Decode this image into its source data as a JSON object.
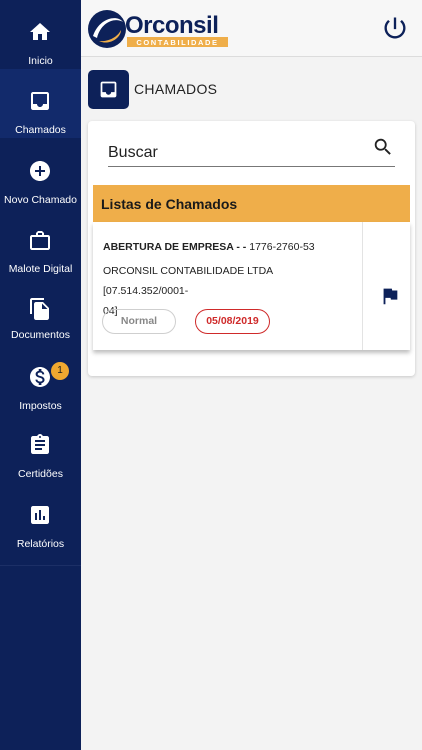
{
  "sidebar": {
    "items": [
      {
        "label": "Inicio",
        "icon": "home-icon"
      },
      {
        "label": "Chamados",
        "icon": "inbox-icon",
        "active": true
      },
      {
        "label": "Novo Chamado",
        "icon": "add-circle-icon"
      },
      {
        "label": "Malote Digital",
        "icon": "briefcase-icon"
      },
      {
        "label": "Documentos",
        "icon": "documents-icon"
      },
      {
        "label": "Impostos",
        "icon": "dollar-icon",
        "badge": "1"
      },
      {
        "label": "Certidões",
        "icon": "clipboard-icon"
      },
      {
        "label": "Relatórios",
        "icon": "bar-chart-icon"
      }
    ]
  },
  "header": {
    "logo_text": "Orconsil",
    "logo_subtext": "CONTABILIDADE",
    "power_icon": "power-icon"
  },
  "page": {
    "title": "CHAMADOS",
    "icon": "inbox-icon"
  },
  "search": {
    "placeholder": "Buscar",
    "icon": "search-icon"
  },
  "list": {
    "header": "Listas de Chamados",
    "tickets": [
      {
        "title": "ABERTURA DE EMPRESA - -",
        "number": "1776-2760-53",
        "company_line1": "ORCONSIL CONTABILIDADE LTDA [07.514.352/0001-",
        "company_line2": "04]",
        "priority": "Normal",
        "date": "05/08/2019",
        "flag_icon": "flag-icon"
      }
    ]
  },
  "colors": {
    "navy": "#0d2159",
    "accent_orange": "#efae4a",
    "date_red": "#cf2a2a"
  }
}
